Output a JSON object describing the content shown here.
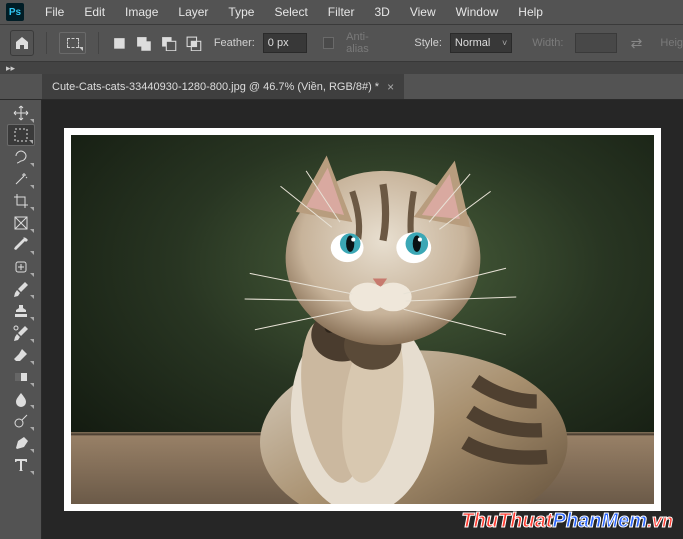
{
  "menubar": {
    "logo": "Ps",
    "items": [
      "File",
      "Edit",
      "Image",
      "Layer",
      "Type",
      "Select",
      "Filter",
      "3D",
      "View",
      "Window",
      "Help"
    ]
  },
  "optionsbar": {
    "feather_label": "Feather:",
    "feather_value": "0 px",
    "antialias_label": "Anti-alias",
    "style_label": "Style:",
    "style_value": "Normal",
    "width_label": "Width:",
    "height_label": "Heig"
  },
  "document": {
    "tab_title": "Cute-Cats-cats-33440930-1280-800.jpg @ 46.7% (Viền, RGB/8#) *"
  },
  "tools": [
    {
      "name": "move-tool"
    },
    {
      "name": "marquee-tool",
      "active": true
    },
    {
      "name": "lasso-tool"
    },
    {
      "name": "magic-wand-tool"
    },
    {
      "name": "crop-tool"
    },
    {
      "name": "frame-tool"
    },
    {
      "name": "eyedropper-tool"
    },
    {
      "name": "healing-brush-tool"
    },
    {
      "name": "brush-tool"
    },
    {
      "name": "clone-stamp-tool"
    },
    {
      "name": "history-brush-tool"
    },
    {
      "name": "eraser-tool"
    },
    {
      "name": "gradient-tool"
    },
    {
      "name": "blur-tool"
    },
    {
      "name": "dodge-tool"
    },
    {
      "name": "pen-tool"
    },
    {
      "name": "type-tool"
    }
  ],
  "watermark": {
    "part1": "ThuThuat",
    "part2": "PhanMem",
    "part3": ".vn"
  }
}
